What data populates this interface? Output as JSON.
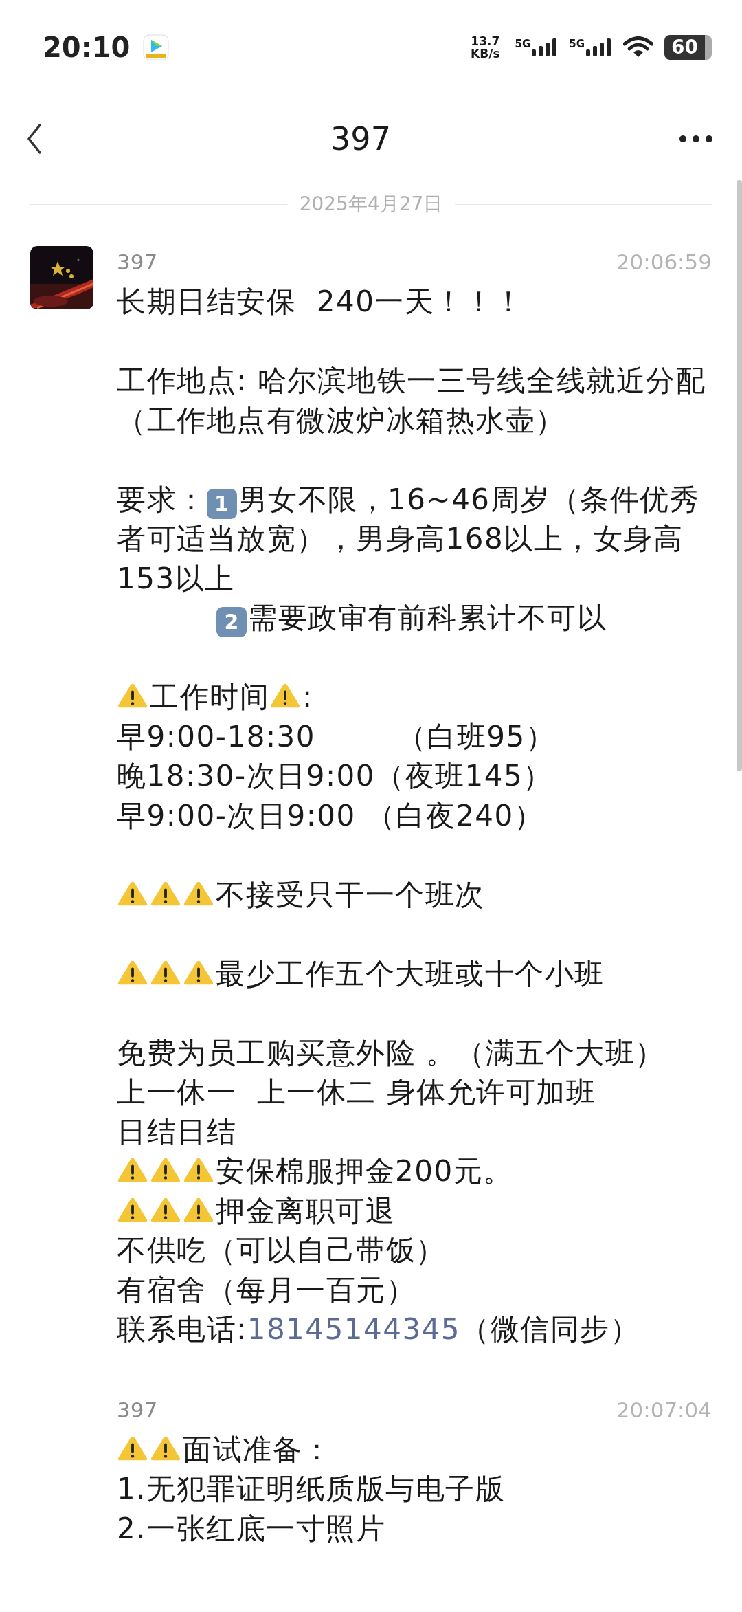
{
  "status_bar": {
    "time": "20:10",
    "net_speed": "13.7",
    "net_unit": "KB/s",
    "signals": [
      {
        "label": "5G"
      },
      {
        "label": "5G"
      }
    ],
    "battery": "60"
  },
  "header": {
    "title": "397"
  },
  "date_divider": "2025年4月27日",
  "messages": [
    {
      "sender": "397",
      "time": "20:06:59",
      "show_avatar": true,
      "lines": [
        {
          "kind": "text",
          "segments": [
            {
              "kind": "text",
              "text": "长期日结安保  240一天！！！"
            }
          ]
        },
        {
          "kind": "blank"
        },
        {
          "kind": "text",
          "segments": [
            {
              "kind": "text",
              "text": "工作地点: 哈尔滨地铁一三号线全线就近分配（工作地点有微波炉冰箱热水壶）"
            }
          ]
        },
        {
          "kind": "blank"
        },
        {
          "kind": "text",
          "segments": [
            {
              "kind": "text",
              "text": "要求："
            },
            {
              "kind": "keycap",
              "text": "1"
            },
            {
              "kind": "text",
              "text": "男女不限，16~46周岁（条件优秀者可适当放宽），男身高168以上，女身高153以上"
            }
          ]
        },
        {
          "kind": "text",
          "indented": true,
          "segments": [
            {
              "kind": "keycap",
              "text": "2"
            },
            {
              "kind": "text",
              "text": "需要政审有前科累计不可以"
            }
          ]
        },
        {
          "kind": "blank"
        },
        {
          "kind": "text",
          "segments": [
            {
              "kind": "warning"
            },
            {
              "kind": "text",
              "text": "工作时间"
            },
            {
              "kind": "warning"
            },
            {
              "kind": "text",
              "text": ":"
            }
          ]
        },
        {
          "kind": "text",
          "segments": [
            {
              "kind": "text",
              "text": "早9:00-18:30        （白班95）"
            }
          ]
        },
        {
          "kind": "text",
          "segments": [
            {
              "kind": "text",
              "text": "晚18:30-次日9:00（夜班145）"
            }
          ]
        },
        {
          "kind": "text",
          "segments": [
            {
              "kind": "text",
              "text": "早9:00-次日9:00 （白夜240）"
            }
          ]
        },
        {
          "kind": "blank"
        },
        {
          "kind": "text",
          "segments": [
            {
              "kind": "warning"
            },
            {
              "kind": "warning"
            },
            {
              "kind": "warning"
            },
            {
              "kind": "text",
              "text": "不接受只干一个班次"
            }
          ]
        },
        {
          "kind": "blank"
        },
        {
          "kind": "text",
          "segments": [
            {
              "kind": "warning"
            },
            {
              "kind": "warning"
            },
            {
              "kind": "warning"
            },
            {
              "kind": "text",
              "text": "最少工作五个大班或十个小班"
            }
          ]
        },
        {
          "kind": "blank"
        },
        {
          "kind": "text",
          "segments": [
            {
              "kind": "text",
              "text": "免费为员工购买意外险 。（满五个大班）"
            }
          ]
        },
        {
          "kind": "text",
          "segments": [
            {
              "kind": "text",
              "text": "上一休一  上一休二 身体允许可加班"
            }
          ]
        },
        {
          "kind": "text",
          "segments": [
            {
              "kind": "text",
              "text": "日结日结"
            }
          ]
        },
        {
          "kind": "text",
          "segments": [
            {
              "kind": "warning"
            },
            {
              "kind": "warning"
            },
            {
              "kind": "warning"
            },
            {
              "kind": "text",
              "text": "安保棉服押金200元。"
            }
          ]
        },
        {
          "kind": "text",
          "segments": [
            {
              "kind": "warning"
            },
            {
              "kind": "warning"
            },
            {
              "kind": "warning"
            },
            {
              "kind": "text",
              "text": "押金离职可退"
            }
          ]
        },
        {
          "kind": "text",
          "segments": [
            {
              "kind": "text",
              "text": "不供吃（可以自己带饭）"
            }
          ]
        },
        {
          "kind": "text",
          "segments": [
            {
              "kind": "text",
              "text": "有宿舍（每月一百元）"
            }
          ]
        },
        {
          "kind": "text",
          "segments": [
            {
              "kind": "text",
              "text": "联系电话:"
            },
            {
              "kind": "link",
              "text": "18145144345"
            },
            {
              "kind": "text",
              "text": "（微信同步）"
            }
          ]
        }
      ]
    },
    {
      "sender": "397",
      "time": "20:07:04",
      "show_avatar": false,
      "lines": [
        {
          "kind": "text",
          "segments": [
            {
              "kind": "warning"
            },
            {
              "kind": "warning"
            },
            {
              "kind": "text",
              "text": "面试准备："
            }
          ]
        },
        {
          "kind": "text",
          "segments": [
            {
              "kind": "text",
              "text": "1.无犯罪证明纸质版与电子版"
            }
          ]
        },
        {
          "kind": "text",
          "segments": [
            {
              "kind": "text",
              "text": "2.一张红底一寸照片"
            }
          ]
        }
      ]
    }
  ]
}
